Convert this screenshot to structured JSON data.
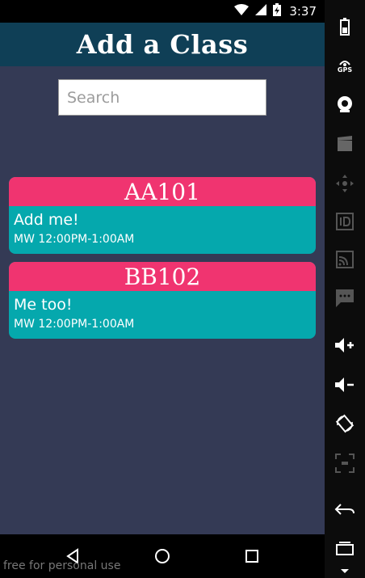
{
  "status_bar": {
    "time": "3:37",
    "icons": [
      "wifi-icon",
      "signal-icon",
      "battery-charging-icon"
    ]
  },
  "header": {
    "title": "Add a Class"
  },
  "search": {
    "placeholder": "Search",
    "value": ""
  },
  "classes": [
    {
      "code": "AA101",
      "title": "Add me!",
      "schedule": "MW 12:00PM-1:00AM"
    },
    {
      "code": "BB102",
      "title": "Me too!",
      "schedule": "MW 12:00PM-1:00AM"
    }
  ],
  "nav": {
    "buttons": [
      "back-icon",
      "home-icon",
      "recents-icon"
    ]
  },
  "watermark": "free for personal use",
  "emulator_toolbar": {
    "gps_label": "GPS",
    "tools": [
      "battery-icon",
      "gps-icon",
      "camera-icon",
      "media-icon",
      "dpad-icon",
      "id-icon",
      "cast-icon",
      "sms-icon",
      "volume-up-icon",
      "volume-down-icon",
      "rotate-icon",
      "pixel-perfect-icon",
      "back-icon",
      "recents-icon"
    ]
  },
  "colors": {
    "background": "#343a55",
    "header": "#0f3f56",
    "card_head": "#f03470",
    "card_body": "#05a8ad"
  }
}
